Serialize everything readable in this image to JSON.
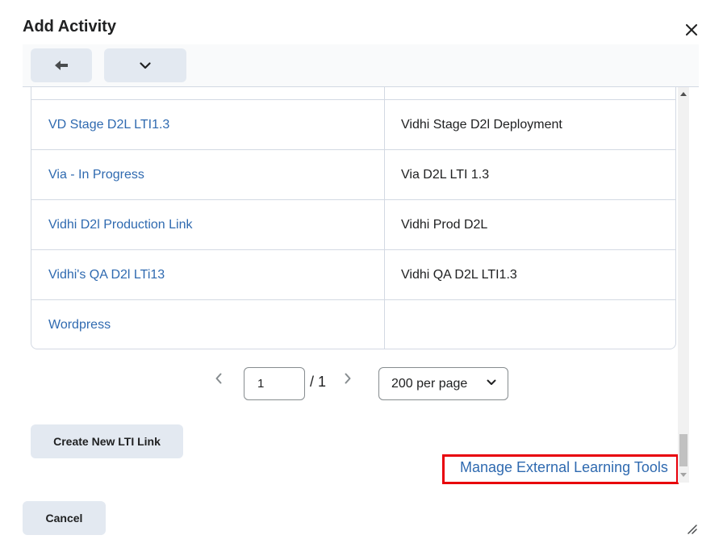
{
  "dialog": {
    "title": "Add Activity",
    "close_icon": "close-icon"
  },
  "toolbar": {
    "back_icon": "arrow-left-icon",
    "more_icon": "chevron-down-icon"
  },
  "table": {
    "rows": [
      {
        "name": "",
        "description": ""
      },
      {
        "name": "VD Stage D2L LTI1.3",
        "description": "Vidhi Stage D2l Deployment"
      },
      {
        "name": "Via - In Progress",
        "description": "Via D2L LTI 1.3"
      },
      {
        "name": "Vidhi D2l Production Link",
        "description": "Vidhi Prod D2L"
      },
      {
        "name": "Vidhi's QA D2l LTi13",
        "description": "Vidhi QA D2L LTI1.3"
      },
      {
        "name": "Wordpress",
        "description": ""
      }
    ]
  },
  "pagination": {
    "current_page": "1",
    "total": "/ 1",
    "per_page": "200 per page",
    "prev_icon": "chevron-left-icon",
    "next_icon": "chevron-right-icon"
  },
  "actions": {
    "create_label": "Create New LTI Link",
    "manage_label": "Manage External Learning Tools",
    "cancel_label": "Cancel"
  },
  "colors": {
    "link": "#2f6ab0",
    "button_bg": "#e3e9f1",
    "highlight": "#e8000b"
  }
}
